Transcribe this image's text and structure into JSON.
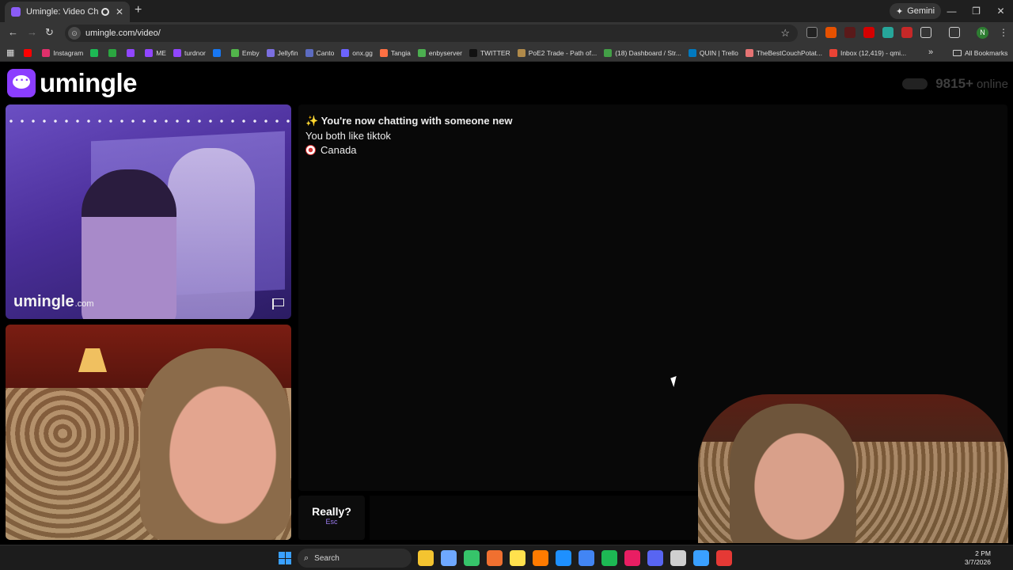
{
  "browser": {
    "tab_title": "Umingle: Video Chat with S",
    "new_tab": "+",
    "gemini_label": "Gemini",
    "url": "umingle.com/video/",
    "profile_initial": "N",
    "bookmarks": [
      {
        "label": "",
        "color": "#ff0000"
      },
      {
        "label": "Instagram",
        "color": "#e1306c"
      },
      {
        "label": "",
        "color": "#1db954"
      },
      {
        "label": "",
        "color": "#2ba640"
      },
      {
        "label": "",
        "color": "#9146ff"
      },
      {
        "label": "ME",
        "color": "#9146ff"
      },
      {
        "label": "turdnor",
        "color": "#9146ff"
      },
      {
        "label": "",
        "color": "#1877f2"
      },
      {
        "label": "Emby",
        "color": "#52b54b"
      },
      {
        "label": "Jellyfin",
        "color": "#7b6fe0"
      },
      {
        "label": "Canto",
        "color": "#5c6bc0"
      },
      {
        "label": "onx.gg",
        "color": "#6c63ff"
      },
      {
        "label": "Tangia",
        "color": "#ff7043"
      },
      {
        "label": "enbyserver",
        "color": "#4caf50"
      },
      {
        "label": "TWITTER",
        "color": "#111111"
      },
      {
        "label": "PoE2 Trade - Path of...",
        "color": "#b08a4a"
      },
      {
        "label": "(18) Dashboard / Str...",
        "color": "#43a047"
      },
      {
        "label": "QUIN | Trello",
        "color": "#0079bf"
      },
      {
        "label": "TheBestCouchPotat...",
        "color": "#e57373"
      },
      {
        "label": "Inbox (12,419) - qmi...",
        "color": "#ea4335"
      }
    ],
    "bookmarks_more": "»",
    "all_bookmarks": "All Bookmarks"
  },
  "site": {
    "logo_text": "umingle",
    "online_count": "9815+",
    "online_label": "online",
    "watermark_name": "umingle",
    "watermark_tld": ".com"
  },
  "chat": {
    "headline": "✨ You're now chatting with someone new",
    "common_interest": "You both like tiktok",
    "country": "Canada"
  },
  "composer": {
    "skip_label": "Really?",
    "skip_key": "Esc",
    "input_value": "",
    "input_placeholder": ""
  },
  "taskbar": {
    "search_label": "Search",
    "time": "2 PM",
    "date": "3/7/2026",
    "icons": [
      "#f4c430",
      "#6ea8ff",
      "#36c46a",
      "#f07030",
      "#ffe14d",
      "#ff7b00",
      "#1e90ff",
      "#4285f4",
      "#1db954",
      "#e91e63",
      "#5865f2",
      "#cfcfcf",
      "#3aa0ff",
      "#e53935"
    ]
  }
}
